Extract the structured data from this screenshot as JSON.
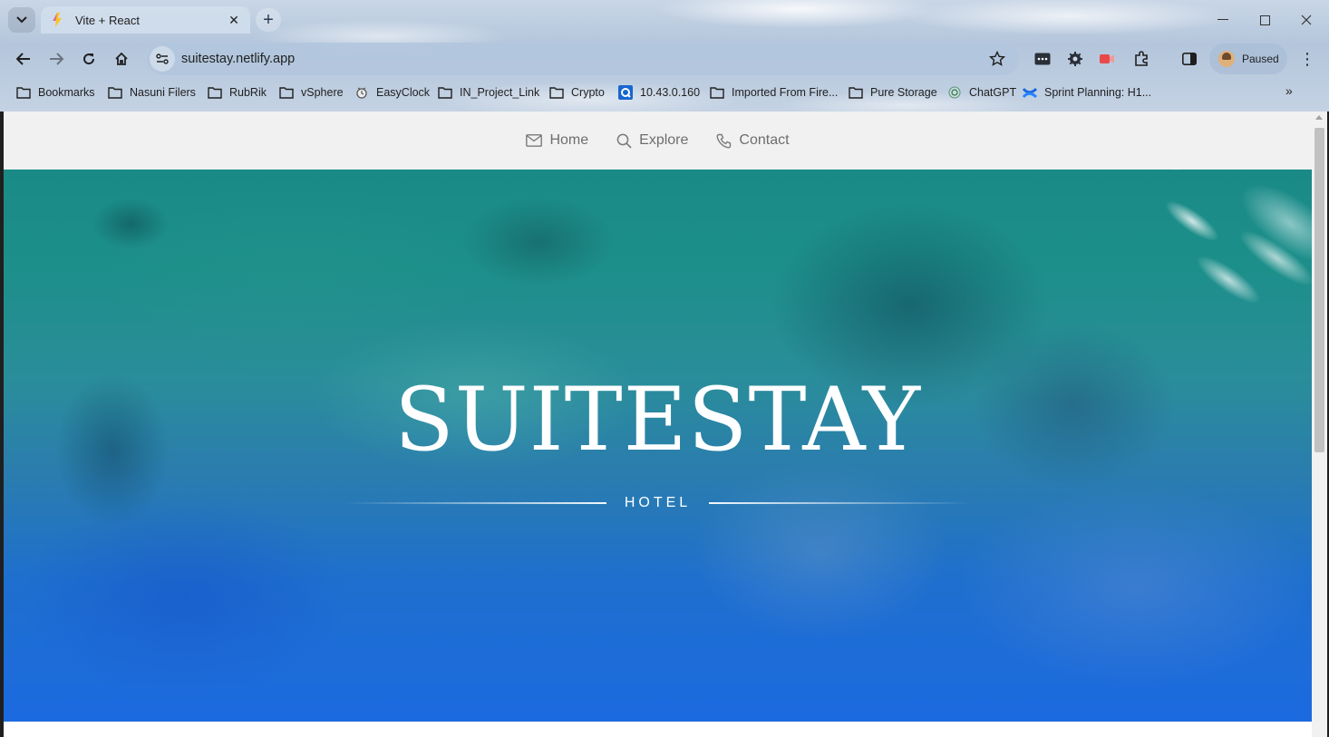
{
  "browser": {
    "tab": {
      "title": "Vite + React",
      "close_glyph": "✕"
    },
    "new_tab_glyph": "+",
    "window_controls": {
      "minimize": "—",
      "maximize": "☐",
      "close": "✕"
    },
    "url": "suitestay.netlify.app",
    "profile": {
      "label": "Paused"
    },
    "menu_glyph": "⋮",
    "bookmarks": [
      {
        "label": "Bookmarks",
        "icon": "folder-icon"
      },
      {
        "label": "Nasuni Filers",
        "icon": "folder-icon"
      },
      {
        "label": "RubRik",
        "icon": "folder-icon"
      },
      {
        "label": "vSphere",
        "icon": "folder-icon"
      },
      {
        "label": "EasyClock",
        "icon": "clock-icon"
      },
      {
        "label": "IN_Project_Link",
        "icon": "folder-icon"
      },
      {
        "label": "Crypto",
        "icon": "folder-icon"
      },
      {
        "label": "10.43.0.160",
        "icon": "q-icon"
      },
      {
        "label": "Imported From Fire...",
        "icon": "folder-icon"
      },
      {
        "label": "Pure Storage",
        "icon": "folder-icon"
      },
      {
        "label": "ChatGPT",
        "icon": "chatgpt-icon"
      },
      {
        "label": "Sprint Planning: H1...",
        "icon": "confluence-icon"
      }
    ],
    "bookmarks_more": "»"
  },
  "site": {
    "nav": [
      {
        "label": "Home",
        "icon": "mail-icon"
      },
      {
        "label": "Explore",
        "icon": "search-icon"
      },
      {
        "label": "Contact",
        "icon": "phone-icon"
      }
    ],
    "hero": {
      "title": "SUITESTAY",
      "subtitle": "HOTEL"
    }
  },
  "colors": {
    "nav_bg": "#f1f1f1",
    "nav_text": "#6e6e6e",
    "hero_text": "#ffffff",
    "ocean_teal": "#1a8a86",
    "ocean_blue": "#1c6ae0"
  }
}
